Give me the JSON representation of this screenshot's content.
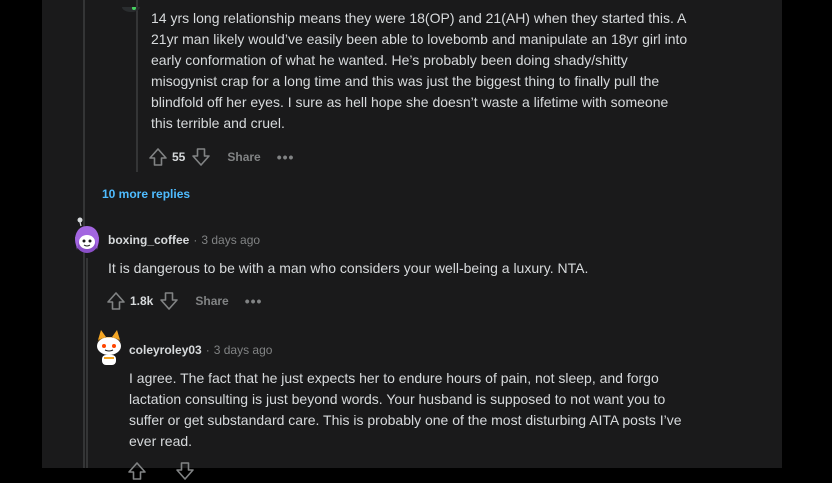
{
  "comments": [
    {
      "text_lines": [
        "14 yrs long relationship means they were 18(OP) and 21(AH) when they started this. A",
        "21yr man likely would’ve easily been able to lovebomb and manipulate an 18yr girl into",
        "early conformation of what he wanted. He’s probably been doing shady/shitty",
        "misogynist crap for a long time and this was just the biggest thing to finally pull the",
        "blindfold off her eyes. I sure as hell hope she doesn’t waste a lifetime with someone",
        "this terrible and cruel."
      ],
      "votes": "55",
      "share_label": "Share",
      "more_label": "•••"
    },
    {
      "username": "boxing_coffee",
      "time": "3 days ago",
      "text_lines": [
        "It is dangerous to be with a man who considers your well-being a luxury. NTA."
      ],
      "votes": "1.8k",
      "share_label": "Share",
      "more_label": "•••"
    },
    {
      "username": "coleyroley03",
      "time": "3 days ago",
      "text_lines": [
        "I agree. The fact that he just expects her to endure hours of pain, not sleep, and forgo",
        "lactation consulting is just beyond words. Your husband is supposed to not want you to",
        "suffer or get substandard care. This is probably one of the most disturbing AITA posts I’ve",
        "ever read."
      ]
    }
  ],
  "more_replies_label": "10 more replies",
  "meta_separator": "·",
  "colors": {
    "background": "#1a1a1b",
    "page": "#000000",
    "text": "#d7dadc",
    "muted": "#818384",
    "link": "#4fbcff",
    "thread_line": "#343536"
  },
  "icons": [
    "upvote-icon",
    "downvote-icon",
    "avatar-snoo"
  ]
}
